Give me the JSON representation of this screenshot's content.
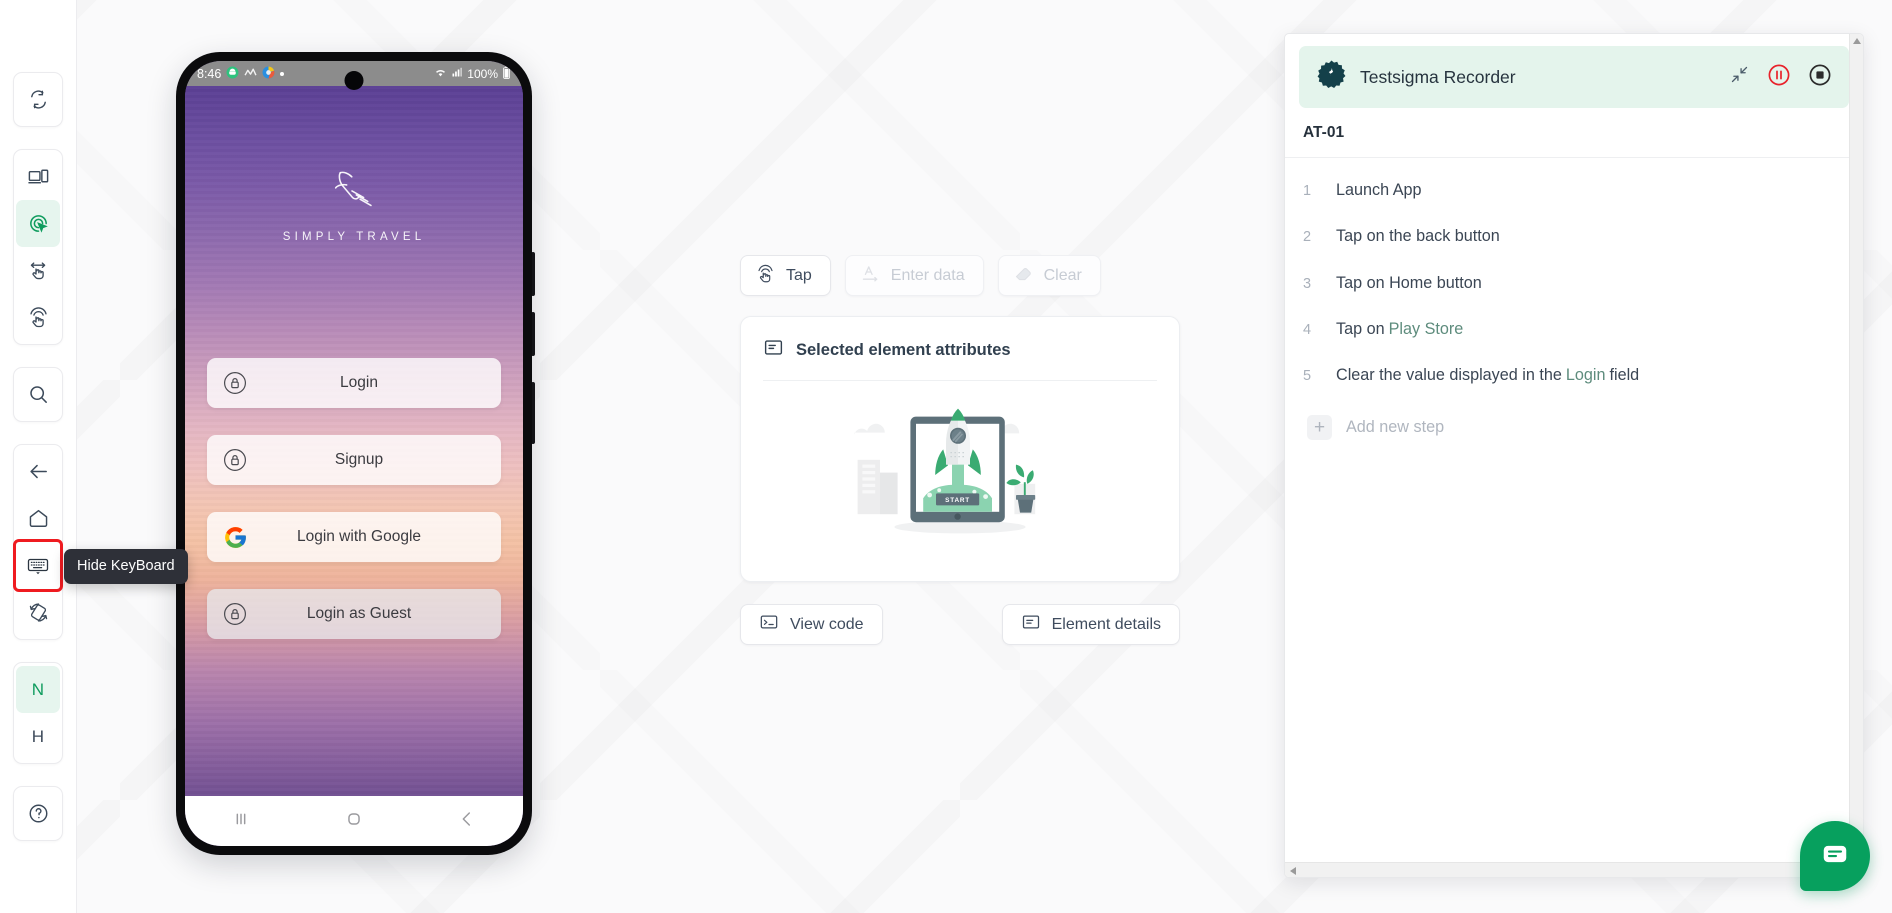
{
  "left_rail": {
    "groups": [
      {
        "items": [
          {
            "name": "refresh-sync",
            "icon": "sync-icon",
            "state": "default"
          }
        ]
      },
      {
        "items": [
          {
            "name": "device-screen",
            "icon": "device-screen-icon",
            "state": "default"
          },
          {
            "name": "inspect-element",
            "icon": "inspect-target-icon",
            "state": "active"
          },
          {
            "name": "swipe-gesture",
            "icon": "swipe-hand-icon",
            "state": "default"
          },
          {
            "name": "tap-gesture",
            "icon": "tap-hand-icon",
            "state": "default"
          }
        ]
      },
      {
        "items": [
          {
            "name": "search",
            "icon": "search-icon",
            "state": "default"
          }
        ]
      },
      {
        "items": [
          {
            "name": "back",
            "icon": "arrow-left-icon",
            "state": "default"
          },
          {
            "name": "home",
            "icon": "home-icon",
            "state": "default"
          },
          {
            "name": "hide-keyboard",
            "icon": "keyboard-icon",
            "state": "selected"
          },
          {
            "name": "rotate-screen",
            "icon": "rotate-device-icon",
            "state": "default"
          }
        ]
      },
      {
        "items": [
          {
            "name": "native-mode",
            "icon": "letter-n",
            "label": "N",
            "state": "active"
          },
          {
            "name": "hybrid-mode",
            "icon": "letter-h",
            "label": "H",
            "state": "default"
          }
        ]
      },
      {
        "items": [
          {
            "name": "help",
            "icon": "question-circle-icon",
            "state": "default"
          }
        ]
      }
    ],
    "tooltip": "Hide KeyBoard"
  },
  "phone": {
    "status_bar": {
      "time": "8:46",
      "battery": "100%",
      "left_icons": [
        "messages-icon",
        "analytics-icon",
        "browser-icon",
        "dot-icon"
      ],
      "right_icons": [
        "wifi-icon",
        "signal-icon",
        "battery-icon"
      ]
    },
    "app": {
      "brand_name": "SIMPLY TRAVEL",
      "logo_icon": "airplane-icon",
      "buttons": [
        {
          "label": "Login",
          "icon": "lock-icon",
          "style": "light"
        },
        {
          "label": "Signup",
          "icon": "lock-icon",
          "style": "light"
        },
        {
          "label": "Login with Google",
          "icon": "google-icon",
          "style": "light"
        },
        {
          "label": "Login as Guest",
          "icon": "lock-icon",
          "style": "muted"
        }
      ]
    },
    "nav_bar": [
      {
        "name": "recents",
        "icon": "recents-icon"
      },
      {
        "name": "home",
        "icon": "home-square-icon"
      },
      {
        "name": "back",
        "icon": "back-chevron-icon"
      }
    ]
  },
  "center": {
    "actions": [
      {
        "label": "Tap",
        "icon": "tap-hand-icon",
        "enabled": true
      },
      {
        "label": "Enter data",
        "icon": "text-input-icon",
        "enabled": false
      },
      {
        "label": "Clear",
        "icon": "eraser-icon",
        "enabled": false
      }
    ],
    "card": {
      "title": "Selected element attributes",
      "title_icon": "document-lines-icon",
      "illustration": "rocket-launch-illustration",
      "illustration_label": "START"
    },
    "footer_buttons": [
      {
        "label": "View code",
        "icon": "terminal-icon"
      },
      {
        "label": "Element details",
        "icon": "document-lines-icon"
      }
    ]
  },
  "recorder": {
    "title": "Testsigma Recorder",
    "logo_icon": "testsigma-gear-icon",
    "header_actions": [
      {
        "name": "collapse",
        "icon": "collapse-arrows-icon"
      },
      {
        "name": "pause",
        "icon": "pause-circle-icon",
        "color": "#e8222b"
      },
      {
        "name": "stop",
        "icon": "stop-circle-icon",
        "color": "#2b2b2b"
      }
    ],
    "test_case_id": "AT-01",
    "steps": [
      {
        "num": "1",
        "parts": [
          {
            "t": "Launch App",
            "k": "plain"
          }
        ]
      },
      {
        "num": "2",
        "parts": [
          {
            "t": "Tap on the back button",
            "k": "plain"
          }
        ]
      },
      {
        "num": "3",
        "parts": [
          {
            "t": "Tap on Home button",
            "k": "plain"
          }
        ]
      },
      {
        "num": "4",
        "parts": [
          {
            "t": "Tap on",
            "k": "plain"
          },
          {
            "t": "Play Store",
            "k": "token"
          }
        ]
      },
      {
        "num": "5",
        "parts": [
          {
            "t": "Clear the value displayed in the",
            "k": "plain"
          },
          {
            "t": "Login",
            "k": "token"
          },
          {
            "t": "field",
            "k": "plain"
          }
        ]
      }
    ],
    "add_step_label": "Add new step",
    "add_step_icon": "plus-icon"
  },
  "chat": {
    "icon": "chat-bubble-icon",
    "color": "#07a05e"
  },
  "colors": {
    "accent_green": "#07a05e",
    "header_green_bg": "#e4f4ec",
    "token_green": "#5e8c7d",
    "danger_red": "#e8222b",
    "select_red": "#ef1b20",
    "text_dark": "#31404f"
  }
}
